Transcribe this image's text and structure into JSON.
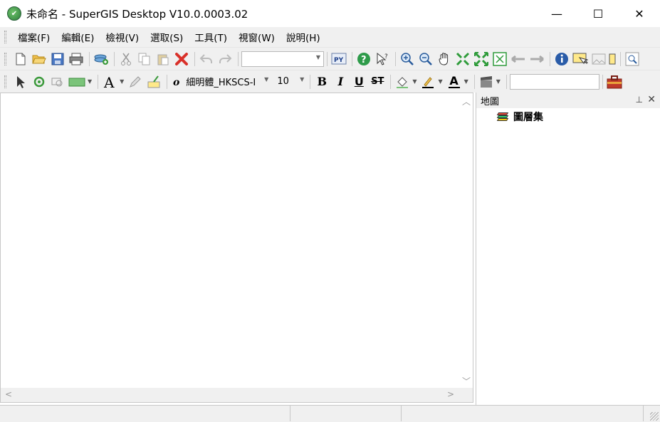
{
  "window": {
    "title": "未命名 - SuperGIS Desktop V10.0.0003.02",
    "minimize_glyph": "—",
    "maximize_glyph": "☐",
    "close_glyph": "✕"
  },
  "menu": {
    "items": [
      "檔案(F)",
      "編輯(E)",
      "檢視(V)",
      "選取(S)",
      "工具(T)",
      "視窗(W)",
      "說明(H)"
    ]
  },
  "toolbar1": {
    "scale_value": ""
  },
  "toolbar2": {
    "font_name": "細明體_HKSCS-I",
    "font_size": "10",
    "bold_label": "B",
    "italic_label": "I",
    "underline_label": "U",
    "strike_label": "ST",
    "text_color_label": "A",
    "search_value": ""
  },
  "panel": {
    "title": "地圖",
    "layers_label": "圖層集"
  },
  "icons": [
    "new-icon",
    "open-icon",
    "save-icon",
    "print-icon",
    "add-data-icon",
    "cut-icon",
    "copy-icon",
    "paste-icon",
    "delete-icon",
    "undo-icon",
    "redo-icon",
    "python-icon",
    "help-icon",
    "whats-this-icon",
    "zoom-in-icon",
    "zoom-out-icon",
    "pan-icon",
    "fixed-zoom-in-icon",
    "fixed-zoom-out-icon",
    "full-extent-icon",
    "back-icon",
    "forward-icon",
    "identify-icon",
    "map-tips-icon"
  ]
}
